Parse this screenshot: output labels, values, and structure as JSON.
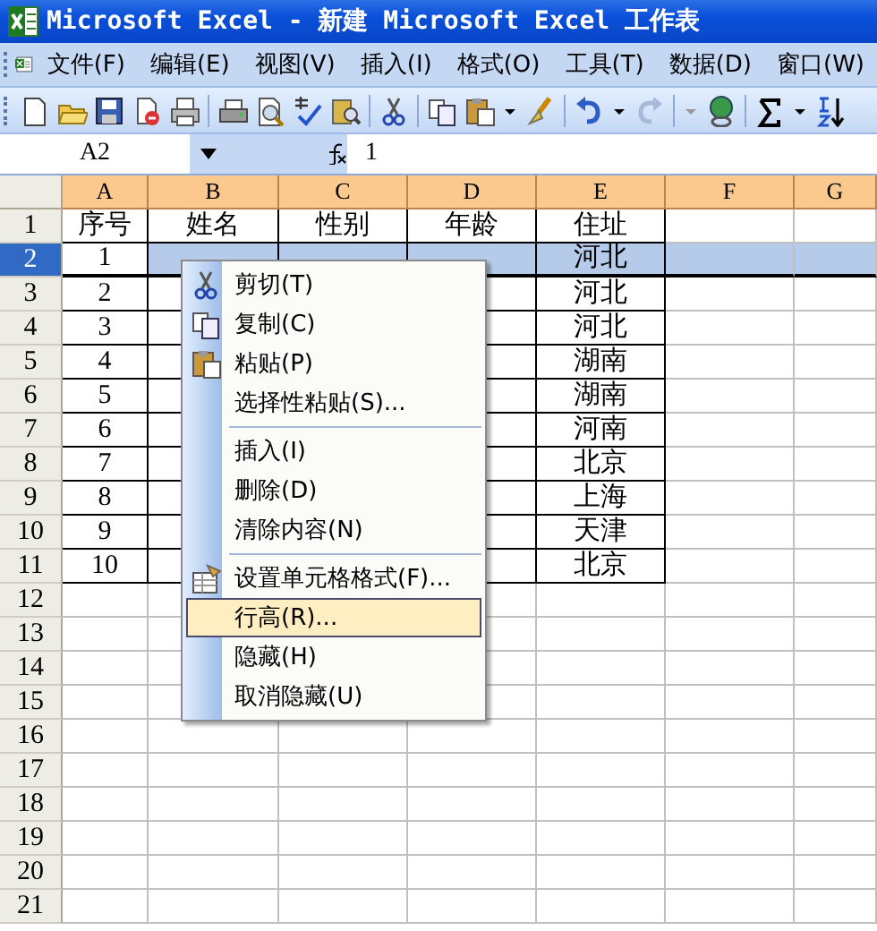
{
  "window": {
    "title": "Microsoft Excel - 新建 Microsoft Excel 工作表"
  },
  "menu_bar": [
    "文件(F)",
    "编辑(E)",
    "视图(V)",
    "插入(I)",
    "格式(O)",
    "工具(T)",
    "数据(D)",
    "窗口(W)"
  ],
  "formula_bar": {
    "name_box": "A2",
    "value": "1"
  },
  "sheet": {
    "columns": [
      "A",
      "B",
      "C",
      "D",
      "E",
      "F",
      "G"
    ],
    "rows": [
      {
        "header": "1",
        "selected": false,
        "cells": [
          {
            "text": "序号"
          },
          {
            "text": "姓名"
          },
          {
            "text": "性别"
          },
          {
            "text": "年龄"
          },
          {
            "text": "住址"
          }
        ]
      },
      {
        "header": "2",
        "selected": true,
        "cells": [
          {
            "text": "1"
          },
          {},
          {},
          {},
          {
            "text": "河北"
          }
        ]
      },
      {
        "header": "3",
        "selected": false,
        "cells": [
          {
            "text": "2"
          },
          {},
          {},
          {},
          {
            "text": "河北"
          }
        ]
      },
      {
        "header": "4",
        "selected": false,
        "cells": [
          {
            "text": "3"
          },
          {},
          {},
          {},
          {
            "text": "河北"
          }
        ]
      },
      {
        "header": "5",
        "selected": false,
        "cells": [
          {
            "text": "4"
          },
          {},
          {},
          {},
          {
            "text": "湖南"
          }
        ]
      },
      {
        "header": "6",
        "selected": false,
        "cells": [
          {
            "text": "5"
          },
          {},
          {},
          {},
          {
            "text": "湖南"
          }
        ]
      },
      {
        "header": "7",
        "selected": false,
        "cells": [
          {
            "text": "6"
          },
          {},
          {},
          {},
          {
            "text": "河南"
          }
        ]
      },
      {
        "header": "8",
        "selected": false,
        "cells": [
          {
            "text": "7"
          },
          {},
          {},
          {},
          {
            "text": "北京"
          }
        ]
      },
      {
        "header": "9",
        "selected": false,
        "cells": [
          {
            "text": "8"
          },
          {},
          {},
          {},
          {
            "text": "上海"
          }
        ]
      },
      {
        "header": "10",
        "selected": false,
        "cells": [
          {
            "text": "9"
          },
          {},
          {},
          {},
          {
            "text": "天津"
          }
        ]
      },
      {
        "header": "11",
        "selected": false,
        "cells": [
          {
            "text": "10"
          },
          {},
          {},
          {},
          {
            "text": "北京"
          }
        ]
      },
      {
        "header": "12",
        "selected": false
      },
      {
        "header": "13",
        "selected": false
      },
      {
        "header": "14",
        "selected": false
      },
      {
        "header": "15",
        "selected": false
      },
      {
        "header": "16",
        "selected": false
      },
      {
        "header": "17",
        "selected": false
      },
      {
        "header": "18",
        "selected": false
      },
      {
        "header": "19",
        "selected": false
      },
      {
        "header": "20",
        "selected": false
      },
      {
        "header": "21",
        "selected": false
      }
    ]
  },
  "context_menu": [
    {
      "label": "剪切(T)",
      "kind": "cut",
      "separator_before": false,
      "selected": false
    },
    {
      "label": "复制(C)",
      "kind": "copy",
      "separator_before": false,
      "selected": false
    },
    {
      "label": "粘贴(P)",
      "kind": "paste",
      "separator_before": false,
      "selected": false
    },
    {
      "label": "选择性粘贴(S)...",
      "kind": "plain",
      "separator_before": false,
      "selected": false
    },
    {
      "label": "插入(I)",
      "kind": "plain",
      "separator_before": true,
      "selected": false
    },
    {
      "label": "删除(D)",
      "kind": "plain",
      "separator_before": false,
      "selected": false
    },
    {
      "label": "清除内容(N)",
      "kind": "plain",
      "separator_before": false,
      "selected": false
    },
    {
      "label": "设置单元格格式(F)...",
      "kind": "format",
      "separator_before": true,
      "selected": false
    },
    {
      "label": "行高(R)...",
      "kind": "plain",
      "separator_before": false,
      "selected": true
    },
    {
      "label": "隐藏(H)",
      "kind": "plain",
      "separator_before": false,
      "selected": false
    },
    {
      "label": "取消隐藏(U)",
      "kind": "plain",
      "separator_before": false,
      "selected": false
    }
  ]
}
